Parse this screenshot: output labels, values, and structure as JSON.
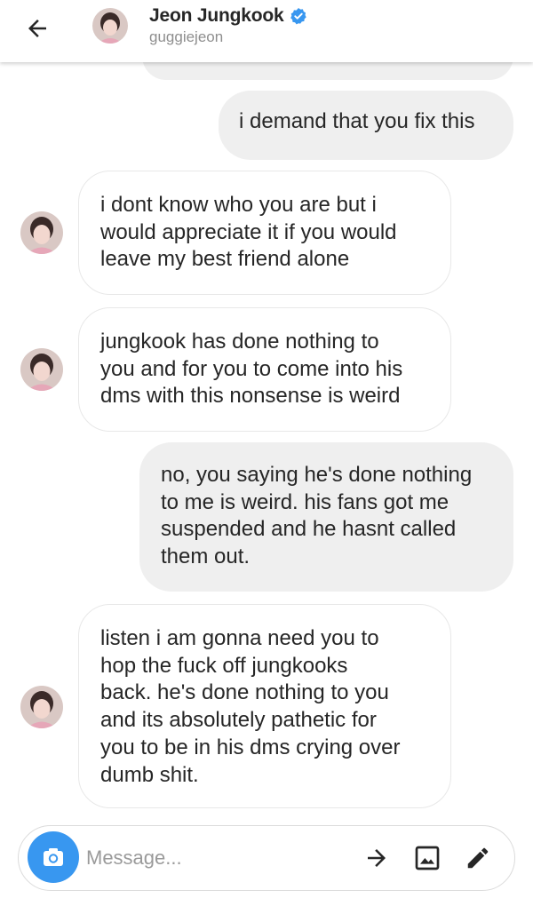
{
  "header": {
    "back_icon": "arrow-left-icon",
    "name": "Jeon Jungkook",
    "verified_icon": "verified-badge-icon",
    "username": "guggiejeon"
  },
  "messages": [
    {
      "side": "sent",
      "text": "i demand that you fix this"
    },
    {
      "side": "received",
      "text": "i dont know who you are but i\nwould appreciate it if you would\nleave my best friend alone"
    },
    {
      "side": "received",
      "text": "jungkook has done nothing to\nyou and for you to come into his\ndms with this nonsense is weird"
    },
    {
      "side": "sent",
      "text": "no, you saying he's done nothing\nto me is weird. his fans got me\nsuspended and he hasnt called\nthem out."
    },
    {
      "side": "received",
      "text": "listen i am gonna need you to\nhop the fuck off jungkooks\nback. he's done nothing to you\nand its absolutely pathetic for\nyou to be in his dms crying over\ndumb shit."
    }
  ],
  "composer": {
    "placeholder": "Message...",
    "camera_icon": "camera-icon",
    "send_icon": "arrow-right-icon",
    "gallery_icon": "image-icon",
    "draw_icon": "pencil-icon"
  },
  "colors": {
    "accent": "#3897f0",
    "sent_bubble": "#efefef",
    "received_border": "#e8e8e8",
    "text": "#262626",
    "muted": "#8e8e8e"
  }
}
